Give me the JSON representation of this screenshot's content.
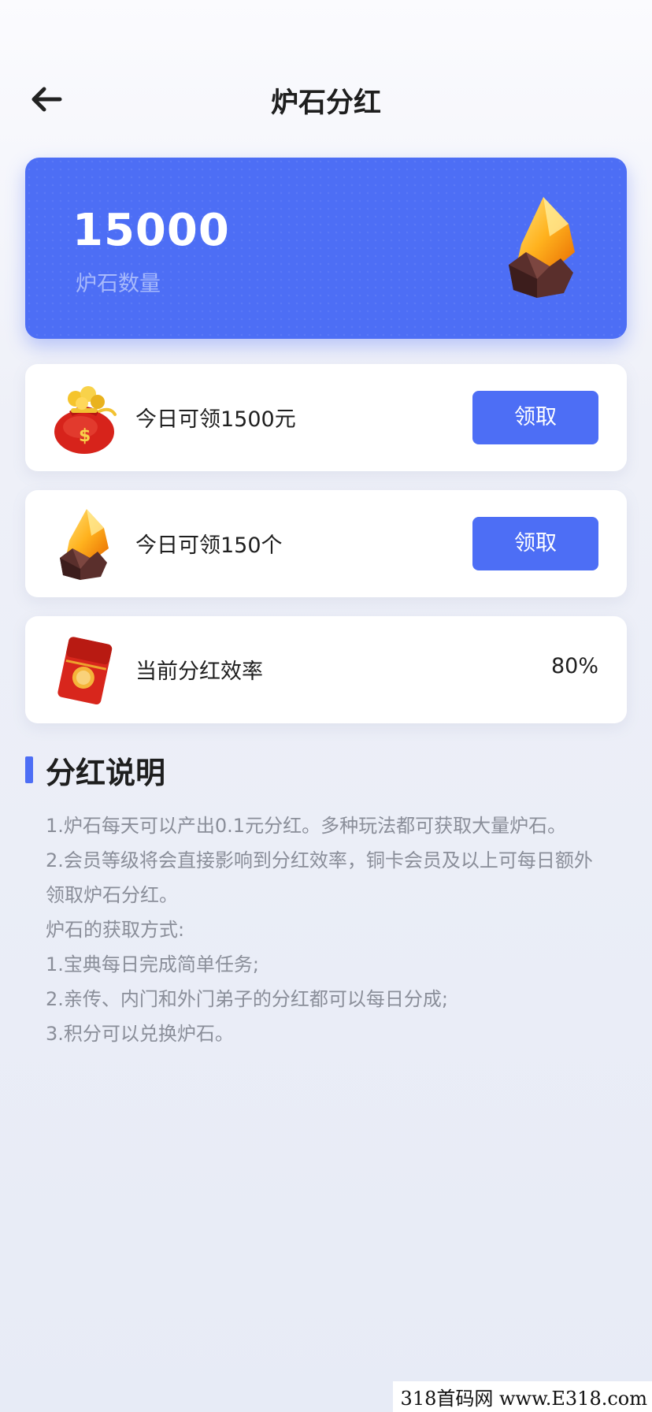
{
  "header": {
    "title": "炉石分红"
  },
  "hero": {
    "count": "15000",
    "label": "炉石数量"
  },
  "rows": [
    {
      "label": "今日可领1500元",
      "button": "领取",
      "icon": "money-bag-icon"
    },
    {
      "label": "今日可领150个",
      "button": "领取",
      "icon": "crystal-icon"
    },
    {
      "label": "当前分红效率",
      "value": "80%",
      "icon": "red-envelope-icon"
    }
  ],
  "section": {
    "title": "分红说明",
    "lines": [
      "1.炉石每天可以产出0.1元分红。多种玩法都可获取大量炉石。",
      "2.会员等级将会直接影响到分红效率，铜卡会员及以上可每日额外",
      "领取炉石分红。",
      "炉石的获取方式:",
      "1.宝典每日完成简单任务;",
      "2.亲传、内门和外门弟子的分红都可以每日分成;",
      "3.积分可以兑换炉石。"
    ]
  },
  "watermark": "318首码网 www.E318.com",
  "colors": {
    "accent": "#4d6ef5",
    "text": "#1f1f1f",
    "muted": "#8a8e99"
  }
}
